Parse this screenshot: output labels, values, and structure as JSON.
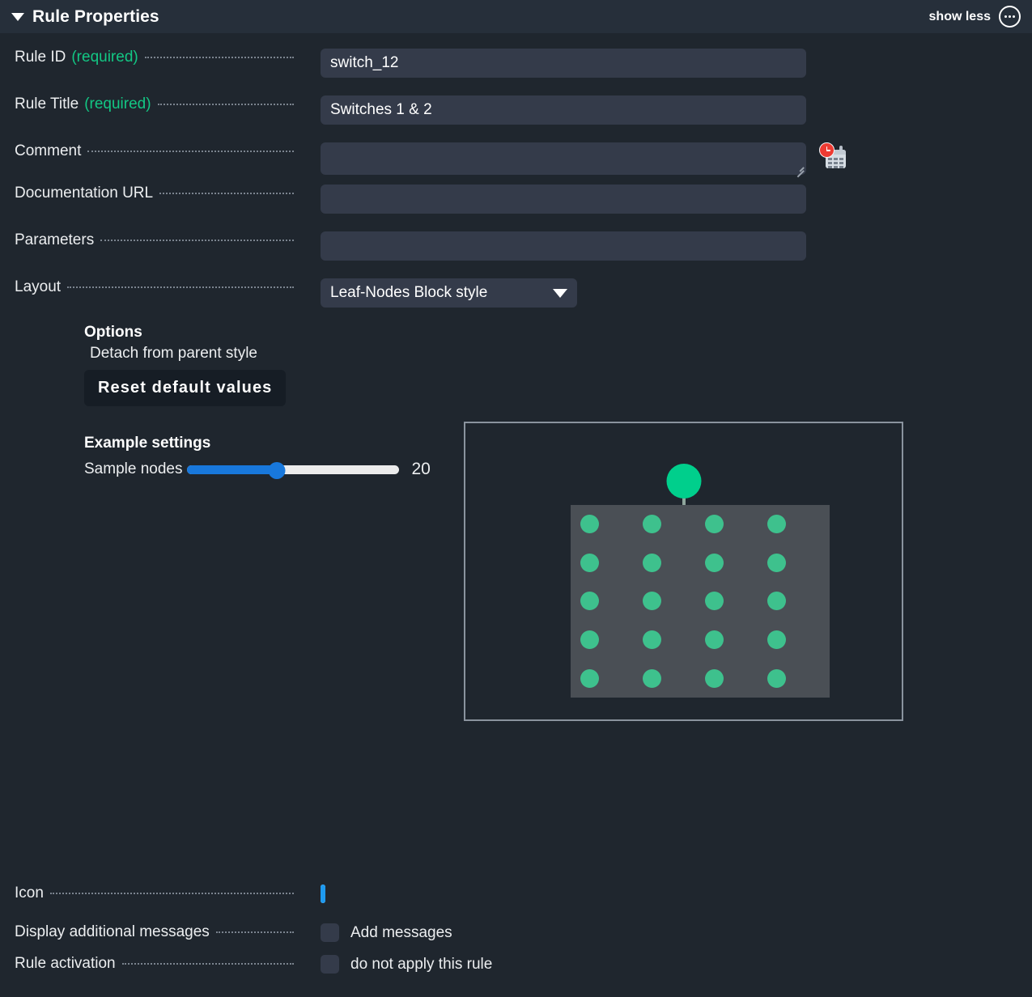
{
  "header": {
    "title": "Rule Properties",
    "collapse_icon": "triangle-down-icon",
    "show_less_label": "show less",
    "more_icon": "ellipsis-circle-icon"
  },
  "fields": {
    "rule_id": {
      "label": "Rule ID",
      "required_text": "(required)",
      "value": "switch_12",
      "placeholder": ""
    },
    "rule_title": {
      "label": "Rule Title",
      "required_text": "(required)",
      "value": "Switches 1 & 2",
      "placeholder": ""
    },
    "comment": {
      "label": "Comment",
      "value": "",
      "placeholder": "",
      "datetime_icon": "calendar-clock-icon"
    },
    "documentation_url": {
      "label": "Documentation URL",
      "value": "",
      "placeholder": ""
    },
    "parameters": {
      "label": "Parameters",
      "value": "",
      "placeholder": ""
    },
    "layout": {
      "label": "Layout",
      "value": "Leaf-Nodes Block style",
      "arrow_icon": "chevron-down-icon"
    },
    "icon": {
      "label": "Icon",
      "swatch_color": "#eef7fe",
      "swatch_border": "#1e9af0"
    },
    "display_messages": {
      "label": "Display additional messages",
      "checkbox_label": "Add messages",
      "checked": false
    },
    "rule_activation": {
      "label": "Rule activation",
      "checkbox_label": "do not apply this rule",
      "checked": false
    }
  },
  "options": {
    "heading": "Options",
    "detach_label": "Detach from parent style",
    "reset_button_label": "Reset default values"
  },
  "example_settings": {
    "heading": "Example settings",
    "slider_label": "Sample nodes",
    "slider_value": "20",
    "slider_percent": 42,
    "slider_fill_color": "#1878dc"
  },
  "preview": {
    "parent_node_color": "#00cf8c",
    "leaf_node_color": "#3ec18d",
    "block_color": "#4a4f55",
    "leaf_count": 20,
    "columns": 4,
    "rows": 5
  },
  "colors": {
    "accent_green": "#13c784",
    "accent_blue": "#1878dc",
    "panel_bg": "#1f262e",
    "header_bg": "#262f3a",
    "input_bg": "#343b4a"
  }
}
